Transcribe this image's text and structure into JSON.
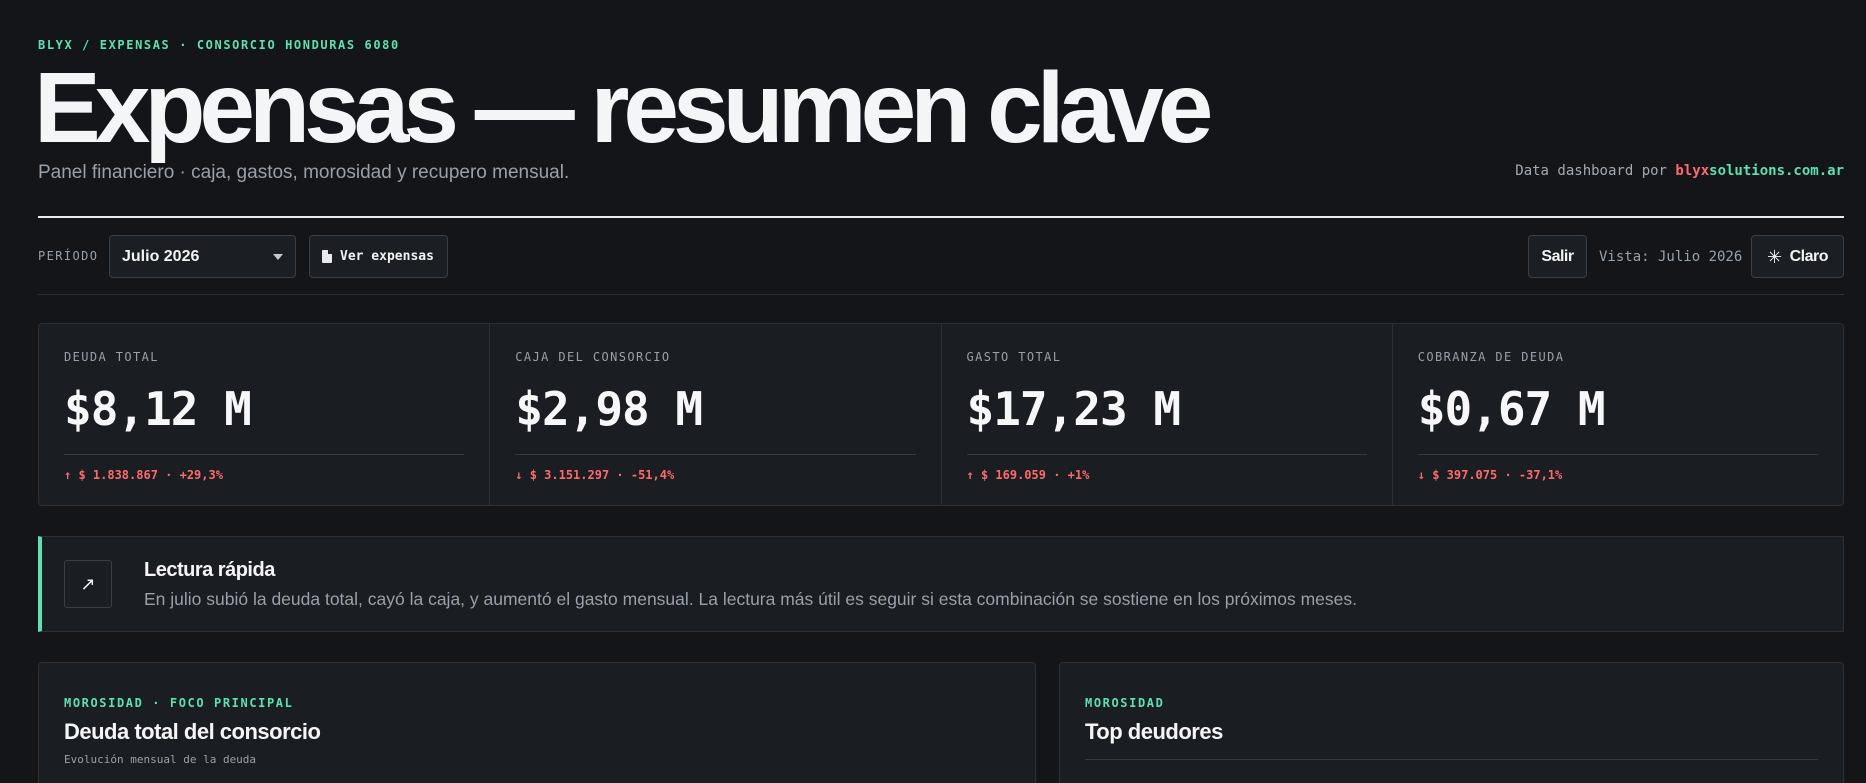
{
  "header": {
    "breadcrumb": "BLYX / EXPENSAS · CONSORCIO HONDURAS 6080",
    "title": "Expensas — resumen clave",
    "subtitle": "Panel financiero · caja, gastos, morosidad y recupero mensual.",
    "credit_prefix": "Data dashboard por",
    "credit_brand_a": "blyx",
    "credit_brand_b": "solutions.com.ar"
  },
  "toolbar": {
    "period_label": "PERÍODO",
    "period_value": "Julio 2026",
    "ver_expensas_label": "Ver expensas",
    "salir_label": "Salir",
    "vista_text": "Vista: Julio 2026",
    "theme_label": "Claro"
  },
  "kpis": [
    {
      "label": "DEUDA TOTAL",
      "value": "$8,12 M",
      "delta": "↑ $ 1.838.867 · +29,3%"
    },
    {
      "label": "CAJA DEL CONSORCIO",
      "value": "$2,98 M",
      "delta": "↓ $ 3.151.297 · -51,4%"
    },
    {
      "label": "GASTO TOTAL",
      "value": "$17,23 M",
      "delta": "↑ $ 169.059 · +1%"
    },
    {
      "label": "COBRANZA DE DEUDA",
      "value": "$0,67 M",
      "delta": "↓ $ 397.075 · -37,1%"
    }
  ],
  "insight": {
    "icon": "↗",
    "title": "Lectura rápida",
    "text": "En julio subió la deuda total, cayó la caja, y aumentó el gasto mensual. La lectura más útil es seguir si esta combinación se sostiene en los próximos meses."
  },
  "panels": {
    "left": {
      "eyebrow": "MOROSIDAD · FOCO PRINCIPAL",
      "title": "Deuda total del consorcio",
      "subtitle": "Evolución mensual de la deuda"
    },
    "right": {
      "eyebrow": "MOROSIDAD",
      "title": "Top deudores"
    }
  },
  "colors": {
    "accent": "#5ee0b0",
    "negative": "#ff6b6b",
    "background": "#131518",
    "card": "#1a1d21"
  }
}
